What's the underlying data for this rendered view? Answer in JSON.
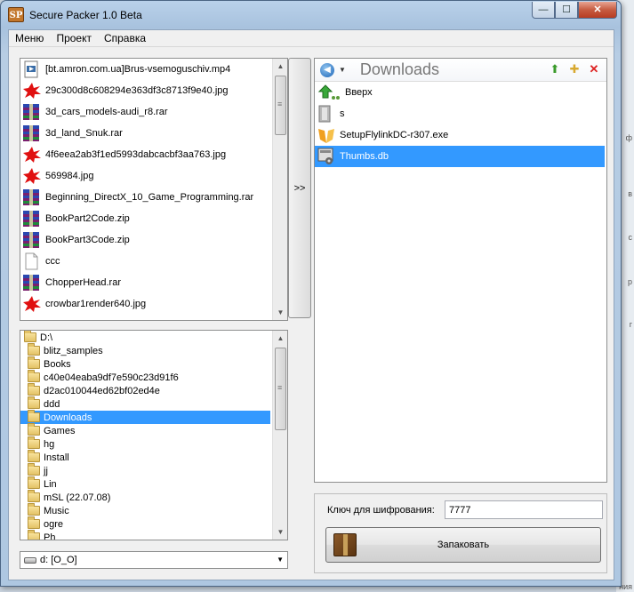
{
  "window": {
    "title": "Secure Packer 1.0 Beta",
    "icon_text": "SP",
    "controls": {
      "minimize": "—",
      "maximize": "☐",
      "close": "✕"
    }
  },
  "menu": [
    "Меню",
    "Проект",
    "Справка"
  ],
  "source_files": [
    {
      "name": "[bt.amron.com.ua]Brus-vsemoguschiv.mp4",
      "icon": "media-file-icon"
    },
    {
      "name": "29c300d8c608294e363df3c8713f9e40.jpg",
      "icon": "image-file-icon"
    },
    {
      "name": "3d_cars_models-audi_r8.rar",
      "icon": "rar-archive-icon"
    },
    {
      "name": "3d_land_Snuk.rar",
      "icon": "rar-archive-icon"
    },
    {
      "name": "4f6eea2ab3f1ed5993dabcacbf3aa763.jpg",
      "icon": "image-file-icon"
    },
    {
      "name": "569984.jpg",
      "icon": "image-file-icon"
    },
    {
      "name": "Beginning_DirectX_10_Game_Programming.rar",
      "icon": "rar-archive-icon"
    },
    {
      "name": "BookPart2Code.zip",
      "icon": "rar-archive-icon"
    },
    {
      "name": "BookPart3Code.zip",
      "icon": "rar-archive-icon"
    },
    {
      "name": "ccc",
      "icon": "blank-file-icon"
    },
    {
      "name": "ChopperHead.rar",
      "icon": "rar-archive-icon"
    },
    {
      "name": "crowbar1render640.jpg",
      "icon": "image-file-icon"
    }
  ],
  "transfer_button": ">>",
  "folder_tree": {
    "root": "D:\\",
    "folders": [
      "blitz_samples",
      "Books",
      "c40e04eaba9df7e590c23d91f6",
      "d2ac010044ed62bf02ed4e",
      "ddd",
      "Downloads",
      "Games",
      "hg",
      "Install",
      "jj",
      "Lin",
      "mSL (22.07.08)",
      "Music",
      "ogre",
      "Ph"
    ],
    "selected": "Downloads"
  },
  "drive_select": {
    "value": "d: [O_O]"
  },
  "target": {
    "title": "Downloads",
    "items": [
      {
        "name": "Вверх",
        "icon": "up-folder-icon"
      },
      {
        "name": "s",
        "icon": "folder-file-icon"
      },
      {
        "name": "SetupFlylinkDC-r307.exe",
        "icon": "exe-file-icon"
      },
      {
        "name": "Thumbs.db",
        "icon": "db-file-icon"
      }
    ],
    "selected": "Thumbs.db"
  },
  "encryption": {
    "label": "Ключ для шифрования:",
    "value": "7777"
  },
  "pack_button": "Запаковать",
  "background_fragments": [
    "ции",
    "ф",
    "в",
    "с",
    "р",
    "г",
    "ния"
  ]
}
